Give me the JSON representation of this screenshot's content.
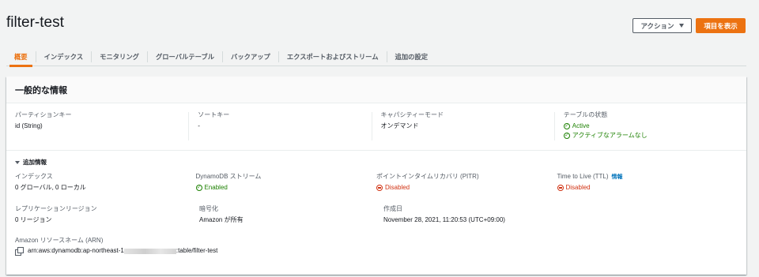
{
  "page": {
    "title": "filter-test"
  },
  "header_actions": {
    "actions_label": "アクション",
    "primary_label": "項目を表示"
  },
  "tabs": [
    {
      "label": "概要",
      "active": true
    },
    {
      "label": "インデックス"
    },
    {
      "label": "モニタリング"
    },
    {
      "label": "グローバルテーブル"
    },
    {
      "label": "バックアップ"
    },
    {
      "label": "エクスポートおよびストリーム"
    },
    {
      "label": "追加の設定"
    }
  ],
  "general": {
    "heading": "一般的な情報",
    "partition_key": {
      "label": "パーティションキー",
      "value": "id (String)"
    },
    "sort_key": {
      "label": "ソートキー",
      "value": "-"
    },
    "capacity_mode": {
      "label": "キャパシティーモード",
      "value": "オンデマンド"
    },
    "table_status": {
      "label": "テーブルの状態",
      "status": "Active",
      "alarms": "アクティブなアラームなし"
    }
  },
  "additional": {
    "toggle_label": "追加情報",
    "indexes": {
      "label": "インデックス",
      "value": "0 グローバル, 0 ローカル"
    },
    "stream": {
      "label": "DynamoDB ストリーム",
      "value": "Enabled"
    },
    "pitr": {
      "label": "ポイントインタイムリカバリ (PITR)",
      "value": "Disabled"
    },
    "ttl": {
      "label": "Time to Live (TTL)",
      "info": "情報",
      "value": "Disabled"
    },
    "replication": {
      "label": "レプリケーションリージョン",
      "value": "0 リージョン"
    },
    "encryption": {
      "label": "暗号化",
      "value": "Amazon が所有"
    },
    "created": {
      "label": "作成日",
      "value": "November 28, 2021, 11:20:53 (UTC+09:00)"
    },
    "arn": {
      "label": "Amazon リソースネーム (ARN)",
      "prefix": "arn:aws:dynamodb:ap-northeast-1",
      "suffix": ":table/filter-test"
    }
  },
  "colors": {
    "accent": "#ec7211",
    "success": "#1d8102",
    "error": "#d13212",
    "link": "#0073bb"
  }
}
